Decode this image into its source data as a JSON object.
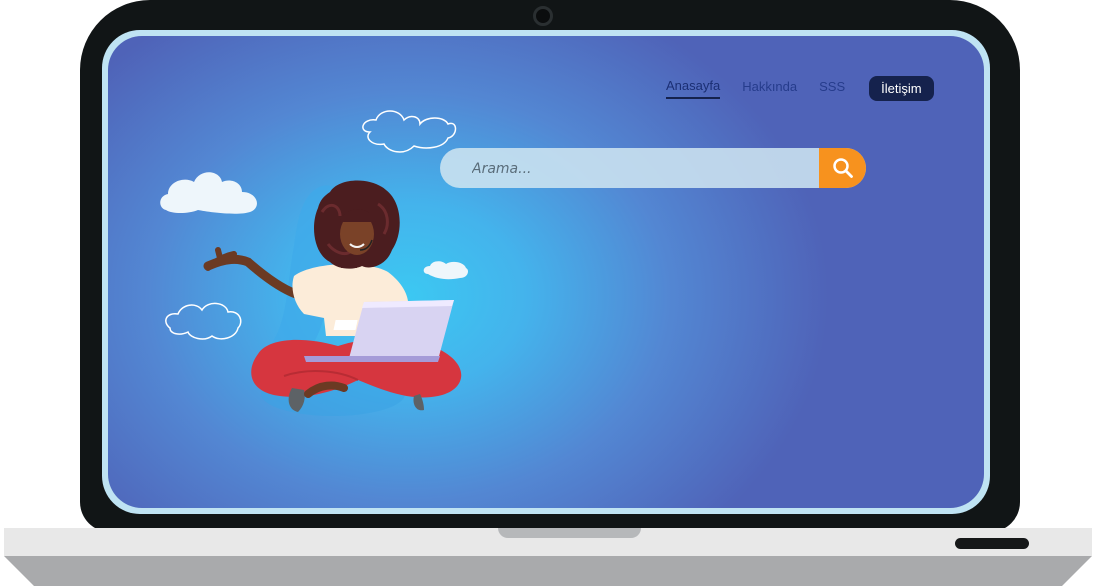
{
  "nav": {
    "items": [
      {
        "label": "Anasayfa",
        "active": true
      },
      {
        "label": "Hakkında",
        "active": false
      },
      {
        "label": "SSS",
        "active": false
      }
    ],
    "contact_label": "İletişim"
  },
  "search": {
    "placeholder": "Arama...",
    "icon": "search-icon"
  },
  "colors": {
    "accent": "#f7921e",
    "nav_button": "#15224d",
    "screen_light": "#3cc8f2",
    "screen_dark": "#4f63b8"
  }
}
